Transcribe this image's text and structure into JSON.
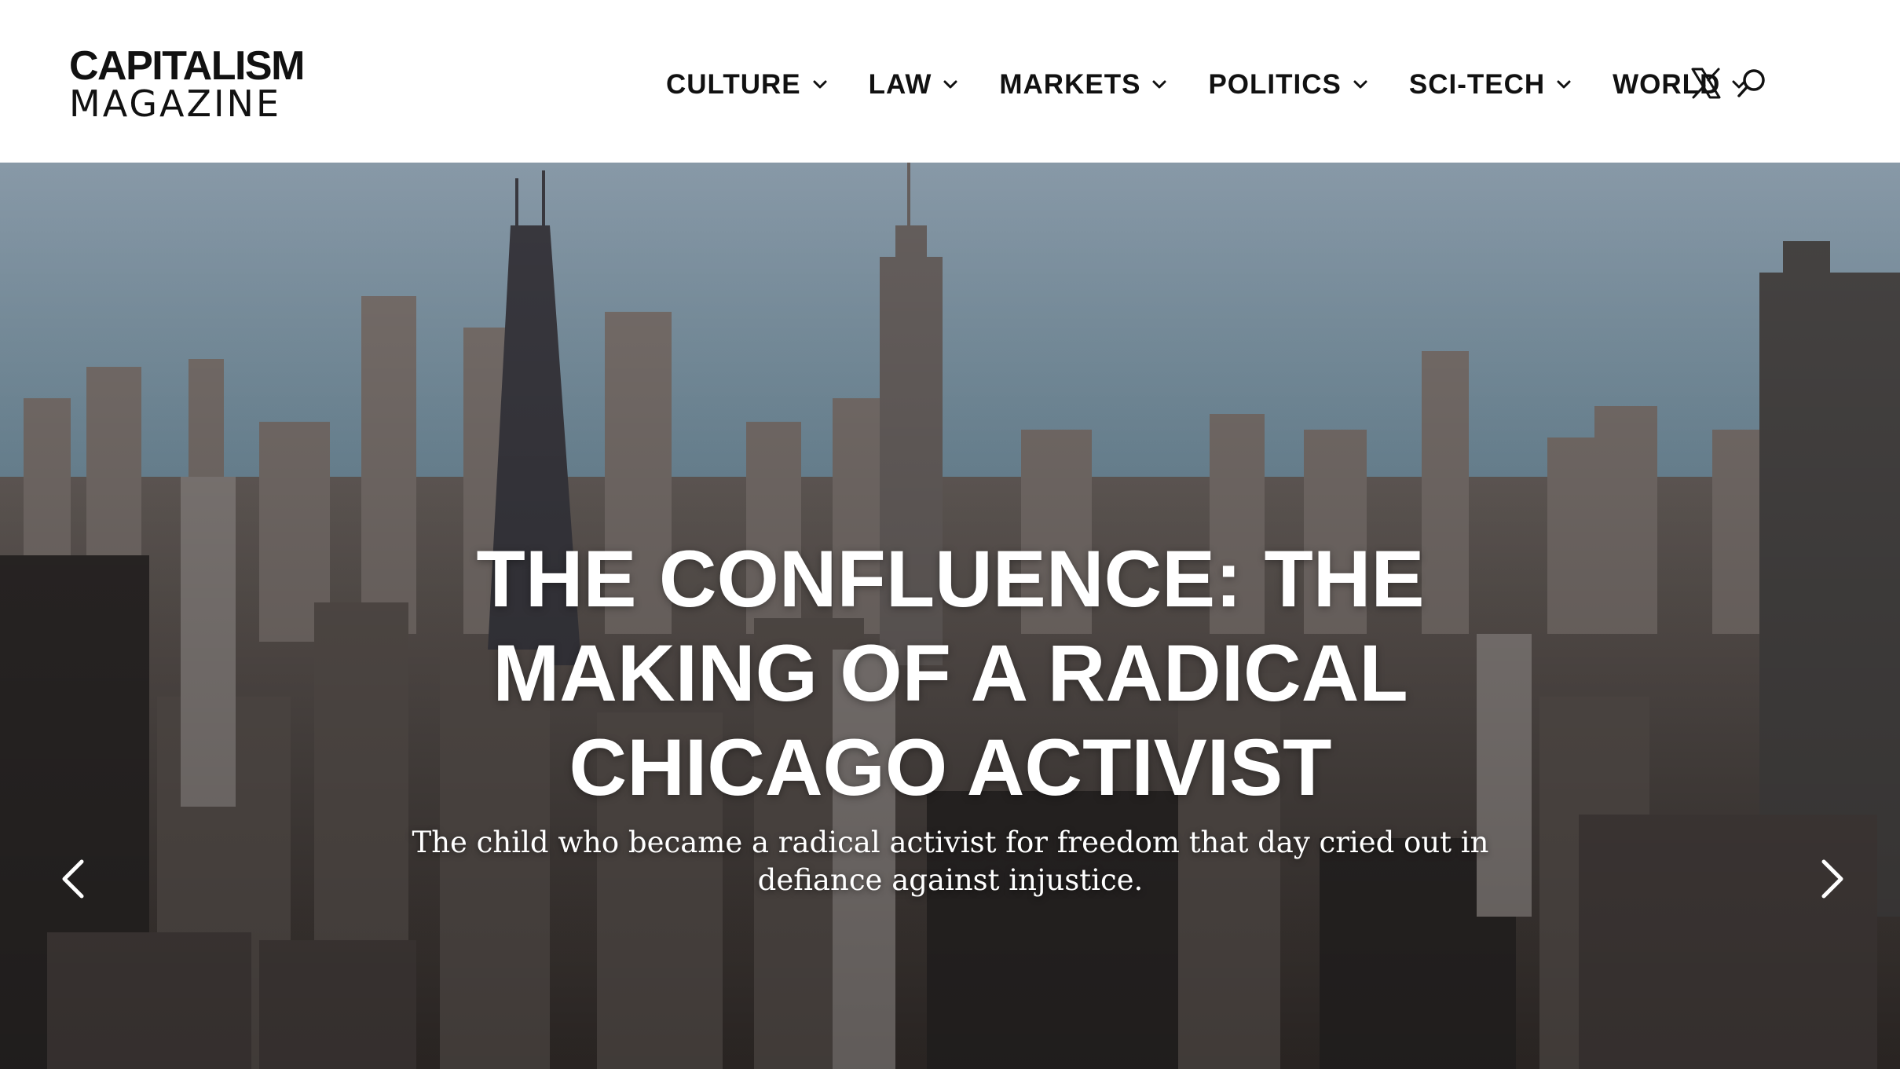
{
  "header": {
    "logo_line1": "CAPITALISM",
    "logo_line2": "MAGAZINE",
    "nav": [
      {
        "label": "CULTURE",
        "icon": "chevron-down-icon"
      },
      {
        "label": "LAW",
        "icon": "chevron-down-icon"
      },
      {
        "label": "MARKETS",
        "icon": "chevron-down-icon"
      },
      {
        "label": "POLITICS",
        "icon": "chevron-down-icon"
      },
      {
        "label": "SCI-TECH",
        "icon": "chevron-down-icon"
      },
      {
        "label": "WORLD",
        "icon": "chevron-down-icon"
      }
    ],
    "icons": [
      "x-social-icon",
      "search-icon"
    ]
  },
  "hero": {
    "title": "THE CONFLUENCE: THE MAKING OF A RADICAL CHICAGO ACTIVIST",
    "subtitle": "The child who became a radical activist for freedom that day cried out in defiance against injustice.",
    "image": "chicago-skyline-aerial",
    "controls": [
      "chevron-left-icon",
      "chevron-right-icon"
    ]
  },
  "colors": {
    "header_bg": "#ffffff",
    "text_dark": "#111111",
    "hero_text": "#ffffff",
    "lake": "#6f8fa3"
  }
}
